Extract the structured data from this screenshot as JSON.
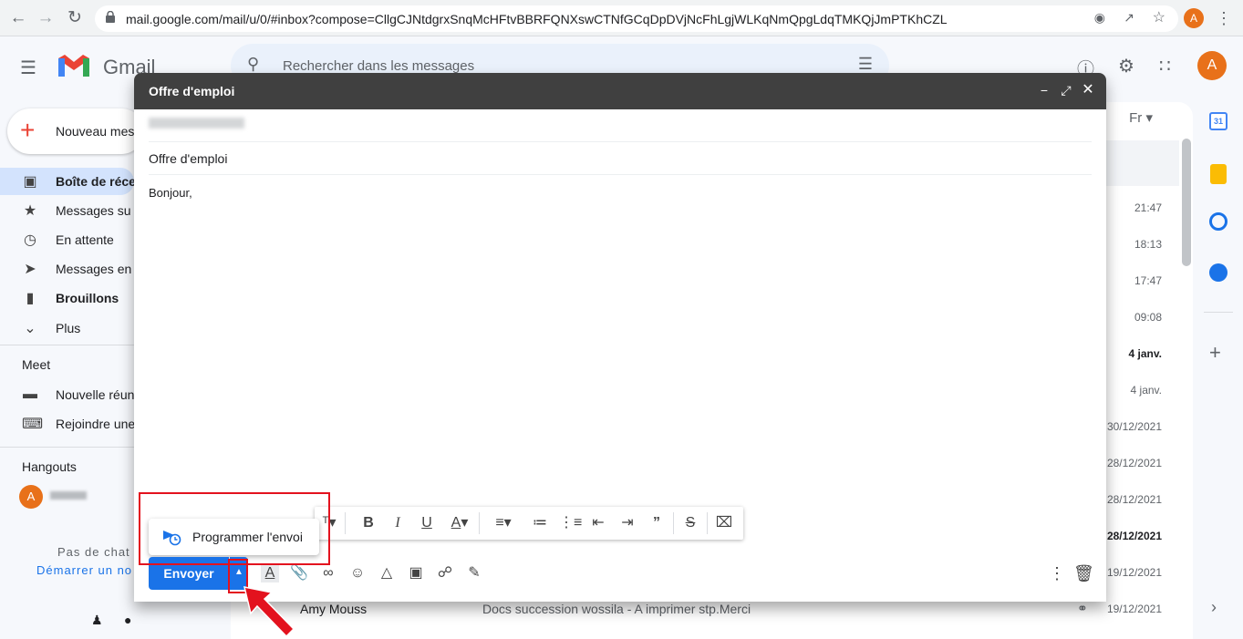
{
  "browser": {
    "url": "mail.google.com/mail/u/0/#inbox?compose=CllgCJNtdgrxSnqMcHFtvBBRFQNXswCTNfGCqDpDVjNcFhLgjWLKqNmQpgLdqTMKQjJmPTKhCZL",
    "profile_initial": "A"
  },
  "gmail": {
    "logo_text": "Gmail",
    "search_placeholder": "Rechercher dans les messages",
    "compose_button": "Nouveau mes",
    "profile_initial": "A",
    "sidebar": [
      {
        "label": "Boîte de réce",
        "icon": "inbox-icon",
        "bold": true
      },
      {
        "label": "Messages su",
        "icon": "star-icon",
        "bold": false
      },
      {
        "label": "En attente",
        "icon": "clock-icon",
        "bold": false
      },
      {
        "label": "Messages en",
        "icon": "send-icon",
        "bold": false
      },
      {
        "label": "Brouillons",
        "icon": "draft-icon",
        "bold": true
      },
      {
        "label": "Plus",
        "icon": "chevron-down-icon",
        "bold": false
      }
    ],
    "meet": {
      "title": "Meet",
      "items": [
        "Nouvelle réun",
        "Rejoindre une"
      ]
    },
    "hangouts": {
      "title": "Hangouts",
      "avatar_initial": "A",
      "no_chat": "Pas de chat",
      "start_link": "Démarrer un no"
    },
    "lang_chip": "Fr",
    "email_times": [
      "21:47",
      "18:13",
      "17:47",
      "09:08",
      "4 janv.",
      "4 janv.",
      "30/12/2021",
      "28/12/2021",
      "28/12/2021",
      "28/12/2021",
      "19/12/2021",
      "19/12/2021"
    ],
    "bold_times": [
      4,
      9
    ],
    "last_row": {
      "sender": "Amy Mouss",
      "subject": "Docs succession wossila - A imprimer stp.Merci",
      "time": "19/12/2021"
    }
  },
  "compose": {
    "header_title": "Offre d'emploi",
    "subject": "Offre d'emploi",
    "body": "Bonjour,",
    "send_label": "Envoyer",
    "schedule_label": "Programmer l'envoi"
  },
  "colors": {
    "accent": "#1a73e8",
    "header": "#404040",
    "highlight": "#e3121e"
  }
}
